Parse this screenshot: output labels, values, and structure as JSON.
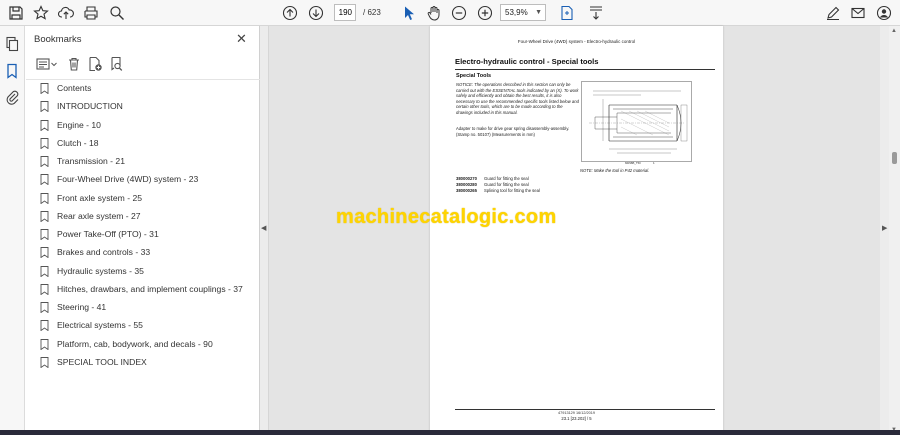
{
  "toolbar": {
    "page_current": "190",
    "page_total": "/ 623",
    "zoom_value": "53,9%"
  },
  "bookmarks_panel": {
    "title": "Bookmarks",
    "items": [
      {
        "label": "Contents"
      },
      {
        "label": "INTRODUCTION"
      },
      {
        "label": "Engine - 10"
      },
      {
        "label": "Clutch - 18"
      },
      {
        "label": "Transmission - 21"
      },
      {
        "label": "Four-Wheel Drive (4WD) system - 23"
      },
      {
        "label": "Front axle system - 25"
      },
      {
        "label": "Rear axle system - 27"
      },
      {
        "label": "Power Take-Off (PTO) - 31"
      },
      {
        "label": "Brakes and controls - 33"
      },
      {
        "label": "Hydraulic systems - 35"
      },
      {
        "label": "Hitches, drawbars, and implement couplings - 37"
      },
      {
        "label": "Steering - 41"
      },
      {
        "label": "Electrical systems - 55"
      },
      {
        "label": "Platform, cab, bodywork, and decals - 90"
      },
      {
        "label": "SPECIAL TOOL INDEX"
      }
    ]
  },
  "document_page": {
    "header": "Four-Wheel Drive (4WD) system - Electro-hydraulic control",
    "title": "Electro-hydraulic control - Special tools",
    "subtitle": "Special Tools",
    "notice": "NOTICE: The operations described in this section can only be carried out with the ESSENTIAL tools indicated by an (X). To work safely and efficiently and obtain the best results, it is also necessary to use the recommended specific tools listed below and certain other tools, which are to be made according to the drawings included in this manual.",
    "adapter_text": "Adapter to make for drive gear spring disassembly-assembly. (Stamp no. 50107) (Measurements in mm)",
    "drawing_caption": "MR98B_T50",
    "drawing_number": "1",
    "note": "NOTE: Make the tool in P42 material.",
    "tools": [
      {
        "code": "380000270",
        "desc": "Guard for fitting the seal"
      },
      {
        "code": "380000280",
        "desc": "Guard for fitting the seal"
      },
      {
        "code": "380000265",
        "desc": "Splining tool for fitting the seal"
      }
    ],
    "footer_line1": "47913129 16/12/2019",
    "footer_line2": "23.1 [23.202] / 5"
  },
  "watermark": "machinecatalogic.com",
  "colors": {
    "toolbar_bg": "#f7f7f7",
    "viewer_bg": "#e4e4e4",
    "active_icon": "#1a5fb4",
    "watermark": "#ffd400"
  }
}
